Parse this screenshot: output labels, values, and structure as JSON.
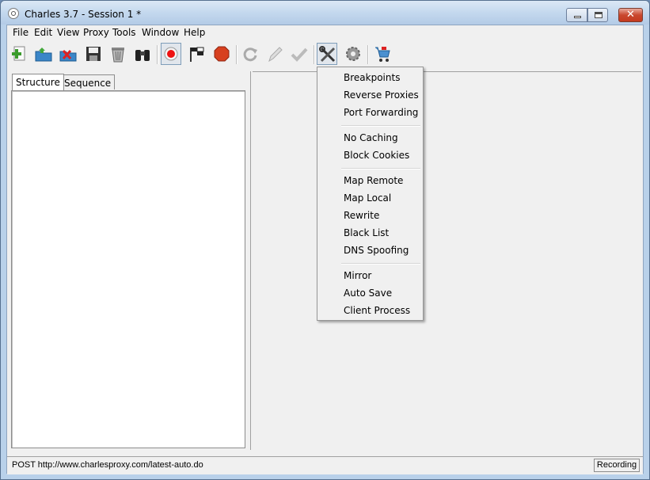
{
  "window": {
    "title": "Charles 3.7 - Session 1 *"
  },
  "menubar": [
    "File",
    "Edit",
    "View",
    "Proxy",
    "Tools",
    "Window",
    "Help"
  ],
  "toolbar": {
    "buttons": [
      {
        "name": "new-session",
        "icon": "plus-document-icon"
      },
      {
        "name": "open-session",
        "icon": "open-folder-icon"
      },
      {
        "name": "close-session",
        "icon": "close-folder-icon"
      },
      {
        "name": "save-session",
        "icon": "floppy-disk-icon"
      },
      {
        "name": "clear-session",
        "icon": "trash-can-icon"
      },
      {
        "name": "find",
        "icon": "binoculars-icon"
      },
      {
        "name": "recording",
        "icon": "record-icon",
        "pressed": true
      },
      {
        "name": "throttling",
        "icon": "checkered-flag-icon"
      },
      {
        "name": "breakpoints",
        "icon": "stop-sign-icon"
      },
      {
        "name": "repeat",
        "icon": "repeat-arrow-icon"
      },
      {
        "name": "edit",
        "icon": "pencil-icon"
      },
      {
        "name": "validate",
        "icon": "checkmark-icon"
      },
      {
        "name": "tools",
        "icon": "wrench-screwdriver-icon",
        "pressed": true
      },
      {
        "name": "settings",
        "icon": "gear-icon"
      },
      {
        "name": "shopping",
        "icon": "shopping-cart-icon"
      }
    ]
  },
  "tabs": [
    "Structure",
    "Sequence"
  ],
  "tools_menu": {
    "groups": [
      [
        "Breakpoints",
        "Reverse Proxies",
        "Port Forwarding"
      ],
      [
        "No Caching",
        "Block Cookies"
      ],
      [
        "Map Remote",
        "Map Local",
        "Rewrite",
        "Black List",
        "DNS Spoofing"
      ],
      [
        "Mirror",
        "Auto Save",
        "Client Process"
      ]
    ]
  },
  "status": {
    "text": "POST http://www.charlesproxy.com/latest-auto.do",
    "badge": "Recording"
  }
}
